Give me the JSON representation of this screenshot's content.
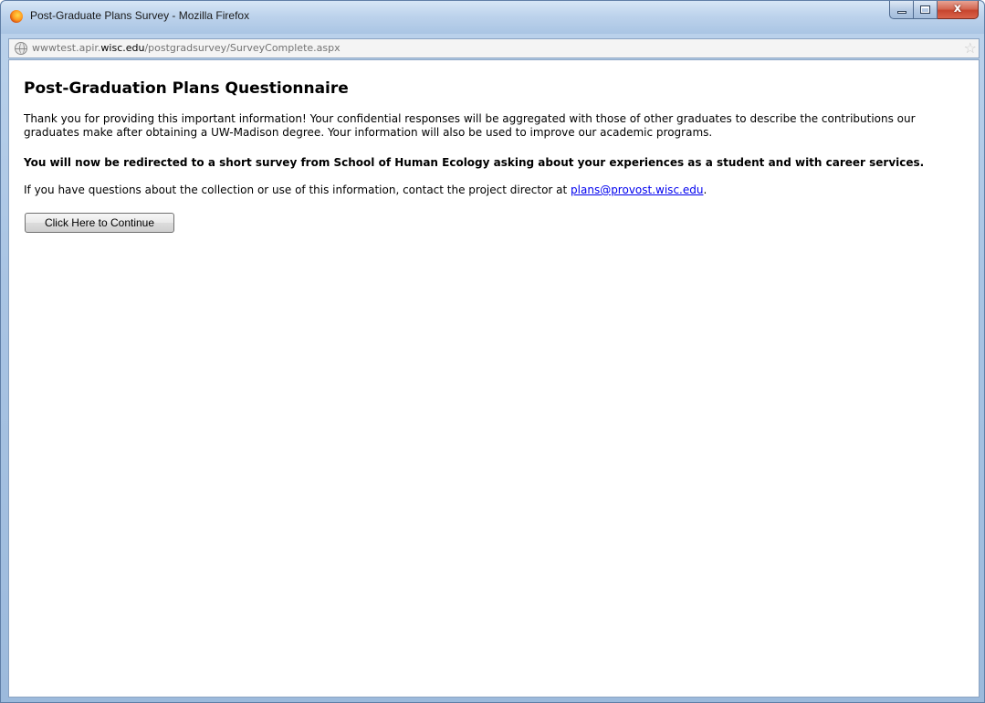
{
  "window": {
    "title": "Post-Graduate Plans Survey - Mozilla Firefox",
    "close_glyph": "x"
  },
  "urlbar": {
    "prefix": "wwwtest.apir.",
    "domain": "wisc.edu",
    "path": "/postgradsurvey/SurveyComplete.aspx"
  },
  "page": {
    "title": "Post-Graduation Plans Questionnaire",
    "paragraph1": "Thank you for providing this important information! Your confidential responses will be aggregated with those of other graduates to describe the contributions our graduates make after obtaining a UW-Madison degree. Your information will also be used to improve our academic programs.",
    "paragraph2": "You will now be redirected to a short survey from School of Human Ecology asking about your experiences as a student and with career services.",
    "paragraph3_before": "If you have questions about the collection or use of this information, contact the project director at ",
    "email": "plans@provost.wisc.edu",
    "paragraph3_after": ".",
    "continue_button": "Click Here to Continue"
  },
  "icons": {
    "app": "firefox-icon",
    "site": "globe-icon",
    "bookmark": "star-icon"
  },
  "colors": {
    "link": "#0000ee",
    "titlebar": "#bdd3ec"
  }
}
